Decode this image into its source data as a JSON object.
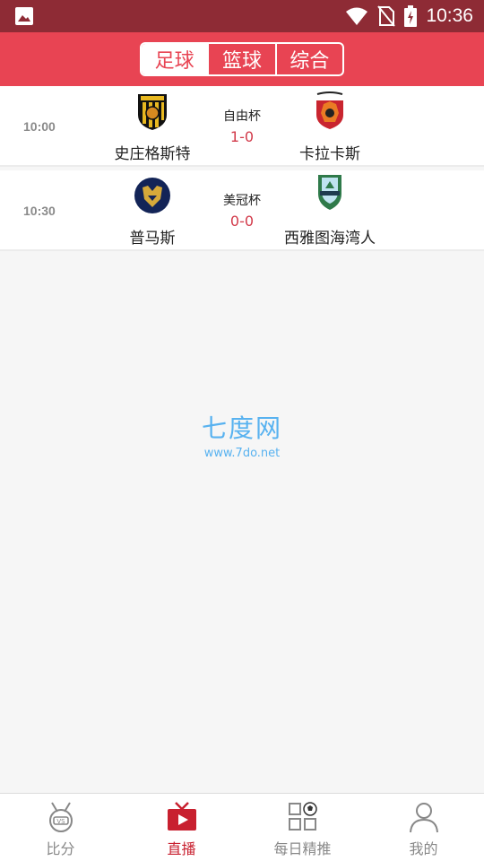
{
  "status_bar": {
    "time": "10:36",
    "icons": [
      "gallery-icon",
      "wifi-icon",
      "no-sim-icon",
      "battery-charging-icon"
    ]
  },
  "header": {
    "tabs": [
      {
        "label": "足球",
        "active": true
      },
      {
        "label": "篮球",
        "active": false
      },
      {
        "label": "综合",
        "active": false
      }
    ]
  },
  "matches": [
    {
      "time": "10:00",
      "cup": "自由杯",
      "score": "1-0",
      "home": {
        "name": "史庄格斯特",
        "logo": "shield-black-yellow-logo"
      },
      "away": {
        "name": "卡拉卡斯",
        "logo": "caracas-fc-logo"
      }
    },
    {
      "time": "10:30",
      "cup": "美冠杯",
      "score": "0-0",
      "home": {
        "name": "普马斯",
        "logo": "pumas-logo"
      },
      "away": {
        "name": "西雅图海湾人",
        "logo": "seattle-sounders-logo"
      }
    }
  ],
  "watermark": {
    "title": "七度网",
    "url": "www.7do.net"
  },
  "bottom_nav": [
    {
      "label": "比分",
      "icon": "vs-medal-icon",
      "active": false
    },
    {
      "label": "直播",
      "icon": "tv-play-icon",
      "active": true
    },
    {
      "label": "每日精推",
      "icon": "grid-ball-icon",
      "active": false
    },
    {
      "label": "我的",
      "icon": "person-icon",
      "active": false
    }
  ],
  "colors": {
    "status_bar": "#8e2b35",
    "header": "#e84453",
    "score": "#d23a4a",
    "nav_active": "#c8202f",
    "watermark": "#58b2f0"
  }
}
